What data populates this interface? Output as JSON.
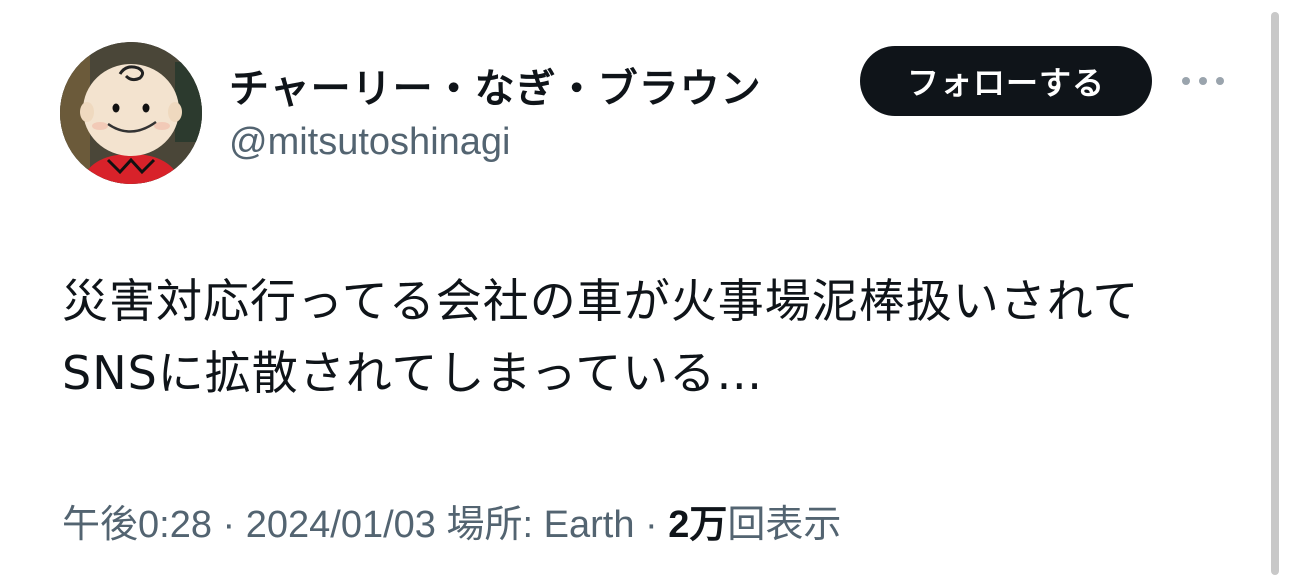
{
  "user": {
    "display_name": "チャーリー・なぎ・ブラウン",
    "handle": "@mitsutoshinagi",
    "avatar_icon": "charlie-brown-figure-avatar"
  },
  "actions": {
    "follow_label": "フォローする",
    "more_icon": "more-dots-icon"
  },
  "tweet": {
    "lines": [
      "災害対応行ってる会社の車が火事場泥棒扱いされて",
      "SNSに拡散されてしまっている…"
    ]
  },
  "meta": {
    "time": "午後0:28",
    "sep1": " · ",
    "date": "2024/01/03",
    "location_label": " 場所: ",
    "location": "Earth",
    "sep2": " · ",
    "views_count": "2万",
    "views_label": "回表示"
  },
  "colors": {
    "text": "#0f1419",
    "secondary": "#536471",
    "follow_bg": "#0f1419",
    "follow_text": "#ffffff"
  }
}
